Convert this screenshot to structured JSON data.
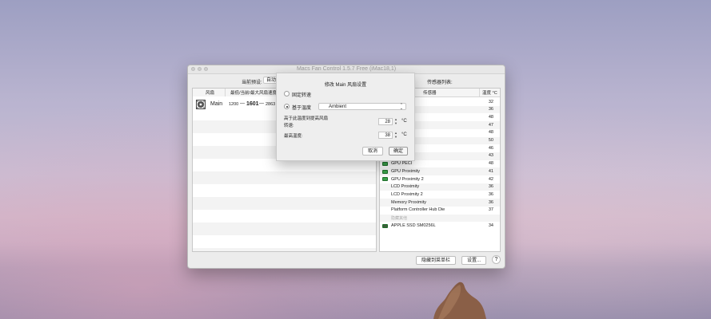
{
  "window": {
    "title": "Macs Fan Control 1.5.7 Free (iMac18,1)",
    "preset_label": "当前预设:",
    "preset_value": "自动",
    "sensors_title": "传感器列表:"
  },
  "fans": {
    "headers": [
      "风扇",
      "最低/当前/最大风扇速度"
    ],
    "rows": [
      {
        "name": "Main",
        "min": "1200",
        "sep": "—",
        "current": "1601",
        "max": "2863"
      }
    ]
  },
  "sensors": {
    "headers": [
      "传感器",
      "温度 °C"
    ],
    "rows": [
      {
        "name": "",
        "value": "32",
        "icon": null
      },
      {
        "name": "",
        "value": "36",
        "icon": null
      },
      {
        "name": "",
        "value": "48",
        "icon": null
      },
      {
        "name": "",
        "value": "47",
        "icon": null
      },
      {
        "name": "",
        "value": "48",
        "icon": null
      },
      {
        "name": "",
        "value": "50",
        "icon": null
      },
      {
        "name": "y",
        "value": "46",
        "icon": null
      },
      {
        "name": "",
        "value": "43",
        "icon": null
      },
      {
        "name": "GPU PECI",
        "value": "48",
        "icon": "gpu-chip-icon"
      },
      {
        "name": "GPU Proximity",
        "value": "41",
        "icon": "gpu-chip-icon"
      },
      {
        "name": "GPU Proximity 2",
        "value": "42",
        "icon": "gpu-chip-icon"
      },
      {
        "name": "LCD Proximity",
        "value": "36",
        "icon": null
      },
      {
        "name": "LCD Proximity 2",
        "value": "36",
        "icon": null
      },
      {
        "name": "Memory Proximity",
        "value": "36",
        "icon": null
      },
      {
        "name": "Platform Controller Hub Die",
        "value": "37",
        "icon": null
      },
      {
        "name": "隐藏其他",
        "value": "",
        "icon": null,
        "dim": true
      },
      {
        "name": "APPLE SSD SM0256L",
        "value": "34",
        "icon": "ssd-drive-icon"
      }
    ]
  },
  "footer": {
    "hide_menu_label": "隐藏到菜单栏",
    "settings_label": "设置...",
    "help_label": "?"
  },
  "dialog": {
    "title": "修改 Main 风扇设置",
    "option_constant": "固定转速",
    "option_sensor": "基于温度",
    "sensor_select": "Ambient",
    "start_label_line1": "高于此温度到提高风扇",
    "start_label_line2": "转速:",
    "start_value": "28",
    "max_label": "最高温度:",
    "max_value": "38",
    "unit": "°C",
    "cancel_label": "取消",
    "ok_label": "确定"
  },
  "colors": {
    "gpu_icon": "#3aa14a",
    "selected_row": "#e8e8e8"
  }
}
